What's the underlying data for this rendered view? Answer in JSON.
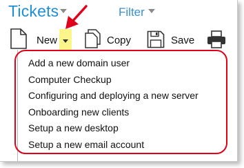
{
  "header": {
    "title": "Tickets",
    "filter_label": "Filter"
  },
  "toolbar": {
    "new_label": "New",
    "copy_label": "Copy",
    "save_label": "Save"
  },
  "menu": {
    "items": [
      "Add a new domain user",
      "Computer Checkup",
      "Configuring and deploying a new server",
      "Onboarding new clients",
      "Setup a new desktop",
      "Setup a new email account"
    ]
  },
  "icons": {
    "new": "new-document-icon",
    "new_dropdown": "chevron-down-icon",
    "copy": "copy-icon",
    "save": "floppy-disk-icon",
    "print": "printer-icon",
    "annotation": "red-arrow-icon"
  },
  "colors": {
    "title": "#1e8fd6",
    "dropdown_highlight": "#fbf58a",
    "annotation_red": "#e0001a"
  }
}
